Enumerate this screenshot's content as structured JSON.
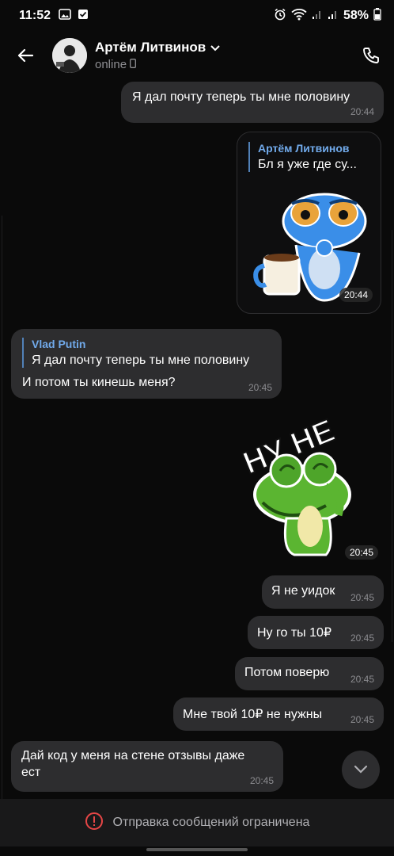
{
  "status_bar": {
    "time": "11:52",
    "battery": "58%"
  },
  "header": {
    "contact_name": "Артём Литвинов",
    "status": "online"
  },
  "messages": [
    {
      "text": "Я дал почту теперь ты мне половину",
      "time": "20:44"
    },
    {
      "reply_name": "Артём Литвинов",
      "reply_text": "Бл я уже где су...",
      "time": "20:44"
    },
    {
      "reply_name": "Vlad Putin",
      "reply_text": "Я дал почту теперь ты мне половину",
      "text": "И потом ты кинешь меня?",
      "time": "20:45"
    },
    {
      "sticker_text": "НУ НЕ",
      "time": "20:45"
    },
    {
      "text": "Я не уидок",
      "time": "20:45"
    },
    {
      "text": "Ну го ты 10₽",
      "time": "20:45"
    },
    {
      "text": "Потом поверю",
      "time": "20:45"
    },
    {
      "text": "Мне твой 10₽ не нужны",
      "time": "20:45"
    },
    {
      "text_line1": "Дай код у меня на стене отзывы даже",
      "text_line2": "ест",
      "time": "20:45"
    }
  ],
  "footer": {
    "restriction_text": "Отправка сообщений ограничена"
  },
  "colors": {
    "background": "#0a0a0a",
    "bubble": "#2d2d2f",
    "reply_accent": "#71aaeb",
    "warning": "#e64646"
  }
}
